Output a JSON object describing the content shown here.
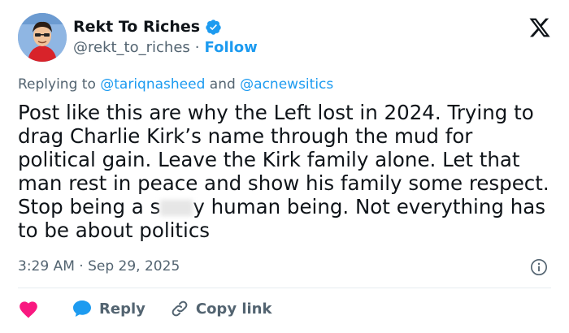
{
  "user": {
    "name": "Rekt To Riches",
    "handle": "@rekt_to_riches",
    "separator": "·",
    "follow_label": "Follow"
  },
  "reply": {
    "prefix": "Replying to",
    "mention1": "@tariqnasheed",
    "and": "and",
    "mention2": "@acnewsitics"
  },
  "post": {
    "text_before": "Post like this are why the Left lost in 2024. Trying to drag Charlie Kirk’s name through the mud for political gain. Leave the Kirk family alone. Let that man rest in peace and show his family some respect. Stop being a s",
    "text_after": "y human being. Not everything has to be about politics"
  },
  "meta": {
    "time": "3:29 AM",
    "separator": "·",
    "date": "Sep 29, 2025"
  },
  "actions": {
    "reply_label": "Reply",
    "copy_label": "Copy link"
  },
  "colors": {
    "accent": "#1d9bf0",
    "heart": "#f91880",
    "text": "#0f1419",
    "muted": "#536471"
  },
  "icons": [
    "verified-badge-icon",
    "x-logo-icon",
    "info-icon",
    "heart-icon",
    "reply-bubble-icon",
    "link-icon"
  ]
}
